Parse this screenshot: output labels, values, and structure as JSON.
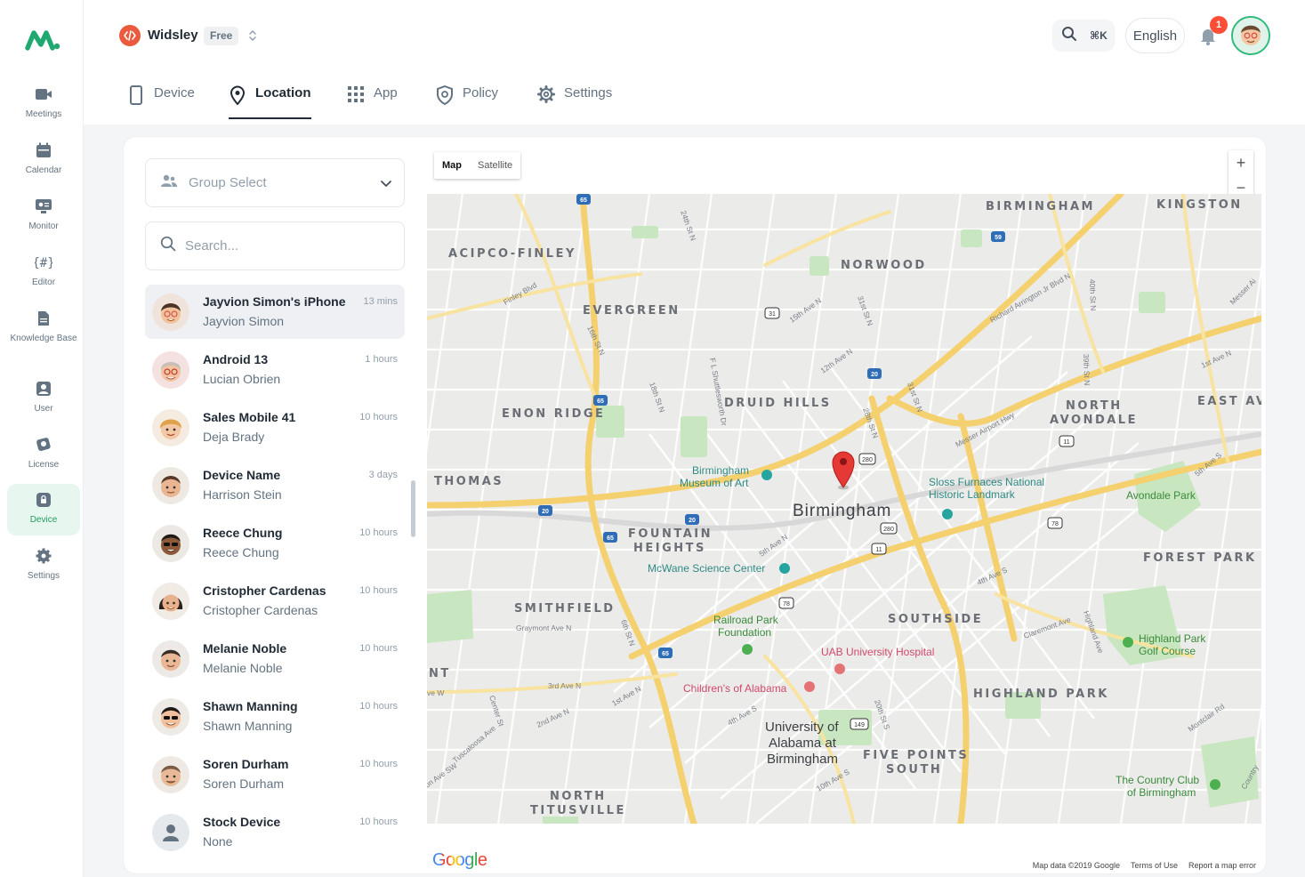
{
  "rail": {
    "items": [
      {
        "label": "Meetings",
        "icon": "video-camera-icon"
      },
      {
        "label": "Calendar",
        "icon": "calendar-icon"
      },
      {
        "label": "Monitor",
        "icon": "monitor-icon"
      },
      {
        "label": "Editor",
        "icon": "hash-editor-icon"
      },
      {
        "label": "Knowledge Base",
        "icon": "document-icon"
      },
      {
        "label": "User",
        "icon": "user-icon"
      },
      {
        "label": "License",
        "icon": "license-icon"
      },
      {
        "label": "Device",
        "icon": "device-lock-icon",
        "active": true
      },
      {
        "label": "Settings",
        "icon": "gear-icon"
      }
    ]
  },
  "header": {
    "workspace_name": "Widsley",
    "plan_badge": "Free",
    "search_shortcut": "⌘K",
    "language": "English",
    "notification_count": "1"
  },
  "tabs": [
    {
      "label": "Device",
      "icon": "phone-icon"
    },
    {
      "label": "Location",
      "icon": "map-pin-icon",
      "active": true
    },
    {
      "label": "App",
      "icon": "grid-icon"
    },
    {
      "label": "Policy",
      "icon": "shield-icon"
    },
    {
      "label": "Settings",
      "icon": "gear-icon"
    }
  ],
  "left_panel": {
    "group_select_placeholder": "Group Select",
    "search_placeholder": "Search...",
    "devices": [
      {
        "title": "Jayvion Simon's iPhone",
        "owner": "Jayvion Simon",
        "time": "13 mins",
        "selected": true
      },
      {
        "title": "Android 13",
        "owner": "Lucian Obrien",
        "time": "1 hours"
      },
      {
        "title": "Sales Mobile 41",
        "owner": "Deja Brady",
        "time": "10 hours"
      },
      {
        "title": "Device Name",
        "owner": "Harrison Stein",
        "time": "3 days"
      },
      {
        "title": "Reece Chung",
        "owner": "Reece Chung",
        "time": "10 hours"
      },
      {
        "title": "Cristopher Cardenas",
        "owner": "Cristopher Cardenas",
        "time": "10 hours"
      },
      {
        "title": "Melanie Noble",
        "owner": "Melanie Noble",
        "time": "10 hours"
      },
      {
        "title": "Shawn Manning",
        "owner": "Shawn Manning",
        "time": "10 hours"
      },
      {
        "title": "Soren Durham",
        "owner": "Soren Durham",
        "time": "10 hours"
      },
      {
        "title": "Stock Device",
        "owner": "None",
        "time": "10 hours"
      }
    ]
  },
  "map": {
    "type_map": "Map",
    "type_satellite": "Satellite",
    "zoom_in": "+",
    "zoom_out": "−",
    "areas": {
      "acipco": "ACIPCO-FINLEY",
      "evergreen": "EVERGREEN",
      "norwood": "NORWOOD",
      "east_birmingham": "BIRMINGHAM",
      "kingston": "KINGSTON",
      "enon_ridge": "ENON RIDGE",
      "druid_hills": "DRUID HILLS",
      "north_avondale_1": "NORTH",
      "north_avondale_2": "AVONDALE",
      "east_av": "EAST AV",
      "thomas": "THOMAS",
      "fountain_1": "FOUNTAIN",
      "fountain_2": "HEIGHTS",
      "forest_park": "FOREST PARK",
      "smithfield": "SMITHFIELD",
      "southside": "SOUTHSIDE",
      "highland_park": "HIGHLAND PARK",
      "five_points_1": "FIVE POINTS",
      "five_points_2": "SOUTH",
      "north_titusville_1": "NORTH",
      "north_titusville_2": "TITUSVILLE",
      "nt": "NT"
    },
    "city": "Birmingham",
    "pois": {
      "museum_1": "Birmingham",
      "museum_2": "Museum of Art",
      "sloss_1": "Sloss Furnaces National",
      "sloss_2": "Historic Landmark",
      "avondale_park": "Avondale Park",
      "mcwane": "McWane Science Center",
      "railroad_1": "Railroad Park",
      "railroad_2": "Foundation",
      "uab": "UAB University Hospital",
      "childrens": "Children's of Alabama",
      "highland_golf_1": "Highland Park",
      "highland_golf_2": "Golf Course",
      "university_1": "University of",
      "university_2": "Alabama at",
      "university_3": "Birmingham",
      "country_club_1": "The Country Club",
      "country_club_2": "of Birmingham"
    },
    "streets": {
      "finley_blvd": "Finley Blvd",
      "s24th": "24th St N",
      "s16th": "16th St N",
      "s18th": "18th St N",
      "shuttlesworth": "F L Shuttlesworth Dr",
      "ave15th": "15th Ave N",
      "ave12th": "12th Ave N",
      "s31st": "31st St N",
      "s28th": "28th St N",
      "s31st_b": "31st St N",
      "messer": "Messer Airport Hwy",
      "arrington": "Richard Arrington Jr Blvd N",
      "s40th": "40th St N",
      "s39th": "39th St N",
      "ave1st": "1st Ave N",
      "messer_a": "Messer Ai",
      "ave5th_s": "5th Ave S",
      "ave5th_n": "5th Ave N",
      "ave4th_s": "4th Ave S",
      "ave3rd": "3rd Ave N",
      "ave2nd": "2nd Ave N",
      "ave1st_b": "1st Ave N",
      "graymont": "Graymont Ave N",
      "s6th": "6th St N",
      "center": "Center St",
      "tuscaloosa": "Tuscaloosa Ave",
      "ave4th_s2": "4th Ave S",
      "s20th": "20th St S",
      "ave10th": "10th Ave S",
      "claremont": "Claremont Ave",
      "highland_ave": "Highland Ave",
      "montclair": "Montclair Rd",
      "ave_w": "ve W",
      "ave_sw": "on Ave SW",
      "country": "Country"
    },
    "google_logo": "Google",
    "attribution": [
      "Map data ©2019 Google",
      "Terms of Use",
      "Report a map error"
    ]
  },
  "colors": {
    "accent_green": "#1f9d63",
    "badge_red": "#ff4d37",
    "highway": "#f6d36b",
    "pin": "#e53935"
  }
}
